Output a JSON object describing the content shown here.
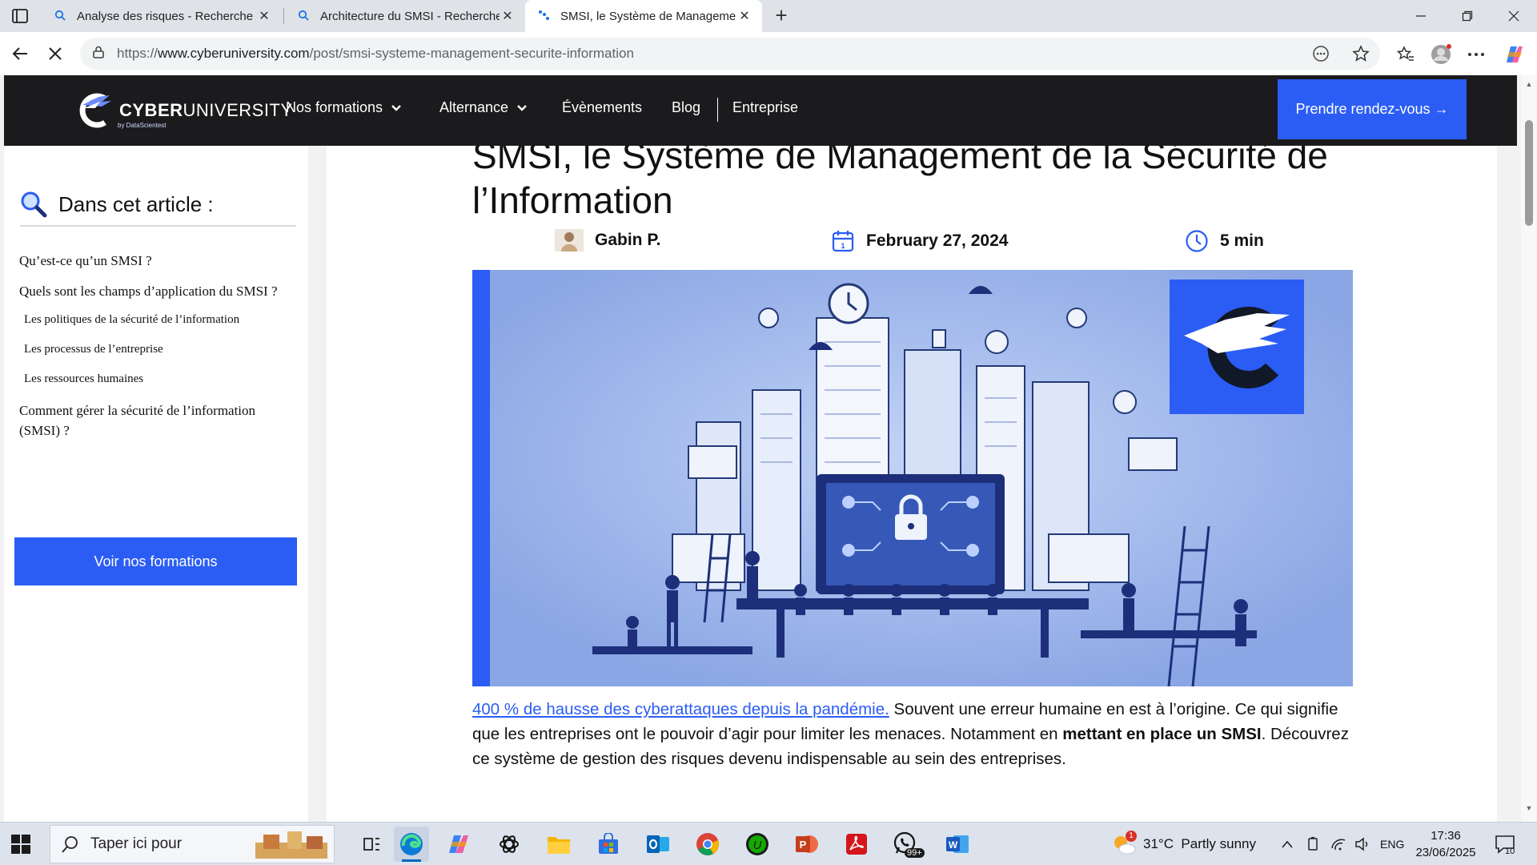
{
  "browser": {
    "tabs": [
      {
        "label": "Analyse des risques - Recherche",
        "icon": "search-icon"
      },
      {
        "label": "Architecture du SMSI - Recherche",
        "icon": "search-icon"
      },
      {
        "label": "SMSI, le Système de Management",
        "icon": "site-favicon",
        "active": true
      }
    ],
    "url_prefix": "https://",
    "url_domain": "www.cyberuniversity.com",
    "url_path": "/post/smsi-systeme-management-securite-information"
  },
  "site": {
    "logo_bold": "CYBER",
    "logo_light": "UNIVERSITY",
    "logo_sub": "by DataScientest",
    "nav": [
      {
        "label": "Nos formations",
        "has_dropdown": true
      },
      {
        "label": "Alternance",
        "has_dropdown": true
      },
      {
        "label": "Évènements",
        "has_dropdown": false
      },
      {
        "label": "Blog",
        "has_dropdown": false
      },
      {
        "label": "Entreprise",
        "has_dropdown": false
      }
    ],
    "cta": "Prendre rendez-vous →",
    "accent": "#2b5df5",
    "header_bg": "#1b1b1d"
  },
  "toc": {
    "title": "Dans cet article :",
    "items": [
      "Qu’est-ce qu’un SMSI ?",
      "Quels sont les champs d’application du SMSI ?",
      "Les politiques de la sécurité de l’information",
      "Les processus de l’entreprise",
      "Les ressources humaines",
      "Comment gérer la sécurité de l’information (SMSI) ?"
    ],
    "button": "Voir nos formations"
  },
  "article": {
    "title": "SMSI, le Système de Management de la Sécurité de l’Information",
    "author": "Gabin P.",
    "date": "February 27, 2024",
    "read_time": "5 min",
    "intro_link": "400 % de hausse des cyberattaques depuis la pandémie.",
    "intro_1": " Souvent une erreur humaine en est à l’origine. Ce qui signifie que les entreprises ont le pouvoir d’agir pour limiter les menaces. Notamment en ",
    "intro_bold": "mettant en place un SMSI",
    "intro_2": ". Découvrez ce système de gestion des risques devenu indispensable au sein des entreprises."
  },
  "taskbar": {
    "search_placeholder": "Taper ici pour",
    "weather": "31°C  Partly sunny",
    "weather_badge": "1",
    "lang": "ENG",
    "time": "17:36",
    "date": "23/06/2025",
    "notif_count": "10",
    "whatsapp_badge": "99+"
  }
}
